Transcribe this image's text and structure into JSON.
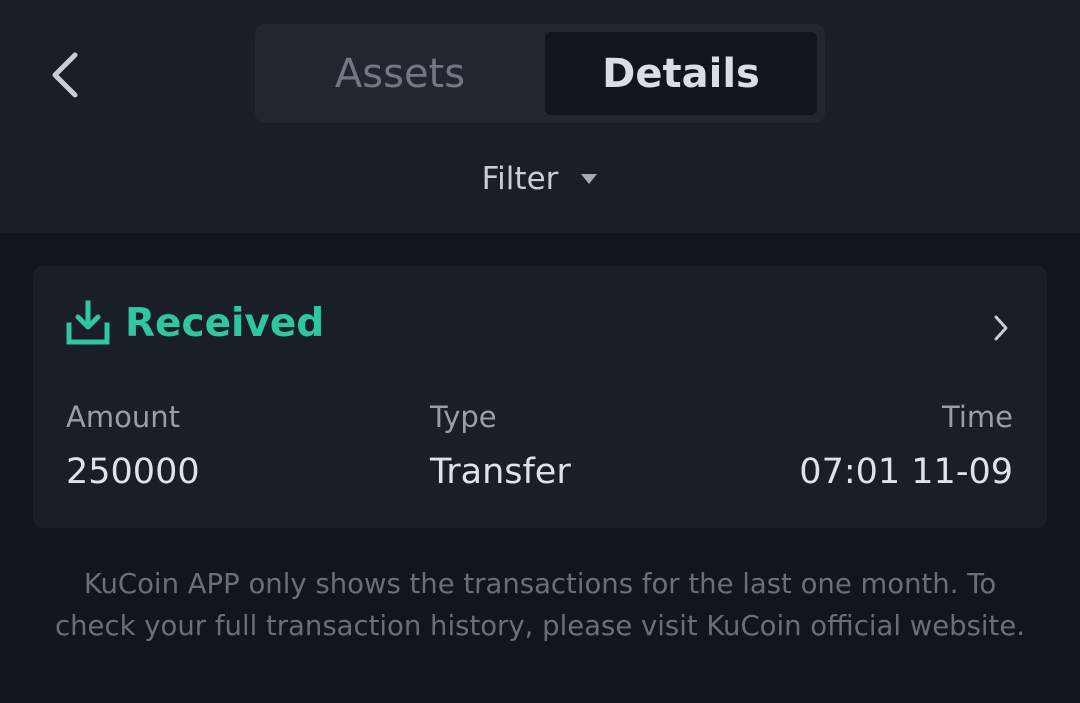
{
  "header": {
    "tabs": [
      {
        "label": "Assets",
        "active": false
      },
      {
        "label": "Details",
        "active": true
      }
    ],
    "filter_label": "Filter"
  },
  "transaction": {
    "status": "Received",
    "columns": {
      "amount_label": "Amount",
      "amount_value": "250000",
      "type_label": "Type",
      "type_value": "Transfer",
      "time_label": "Time",
      "time_value": "07:01 11-09"
    }
  },
  "notice_text": "KuCoin APP only shows the transactions for the last one month. To check your full transaction history, please visit KuCoin official website.",
  "colors": {
    "background": "#11151c",
    "surface": "#1a1e26",
    "accent": "#2ec7a0",
    "text_primary": "#d9dde5",
    "text_muted": "#727781"
  },
  "icons": {
    "back": "chevron-left-icon",
    "filter": "caret-down-icon",
    "status": "download-tray-icon",
    "card_more": "chevron-right-icon"
  }
}
